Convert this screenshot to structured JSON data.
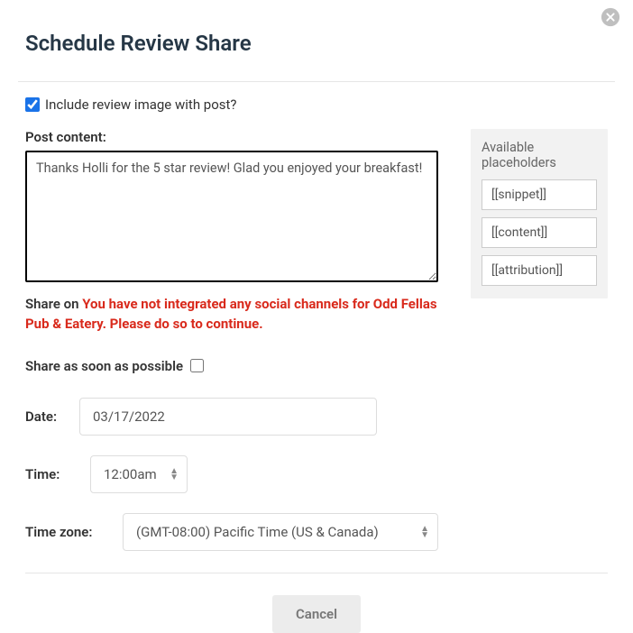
{
  "dialog": {
    "title": "Schedule Review Share"
  },
  "include_image": {
    "label": "Include review image with post?",
    "checked": true
  },
  "post_content": {
    "label": "Post content:",
    "value": "Thanks Holli for the 5 star review! Glad you enjoyed your breakfast!"
  },
  "share_on": {
    "prefix": "Share on ",
    "error": "You have not integrated any social channels for Odd Fellas Pub & Eatery. Please do so to continue."
  },
  "placeholders_panel": {
    "title": "Available placeholders",
    "items": [
      "[[snippet]]",
      "[[content]]",
      "[[attribution]]"
    ]
  },
  "asap": {
    "label": "Share as soon as possible",
    "checked": false
  },
  "date": {
    "label": "Date:",
    "value": "03/17/2022"
  },
  "time": {
    "label": "Time:",
    "value": "12:00am"
  },
  "timezone": {
    "label": "Time zone:",
    "value": "(GMT-08:00) Pacific Time (US & Canada)"
  },
  "footer": {
    "cancel": "Cancel"
  }
}
